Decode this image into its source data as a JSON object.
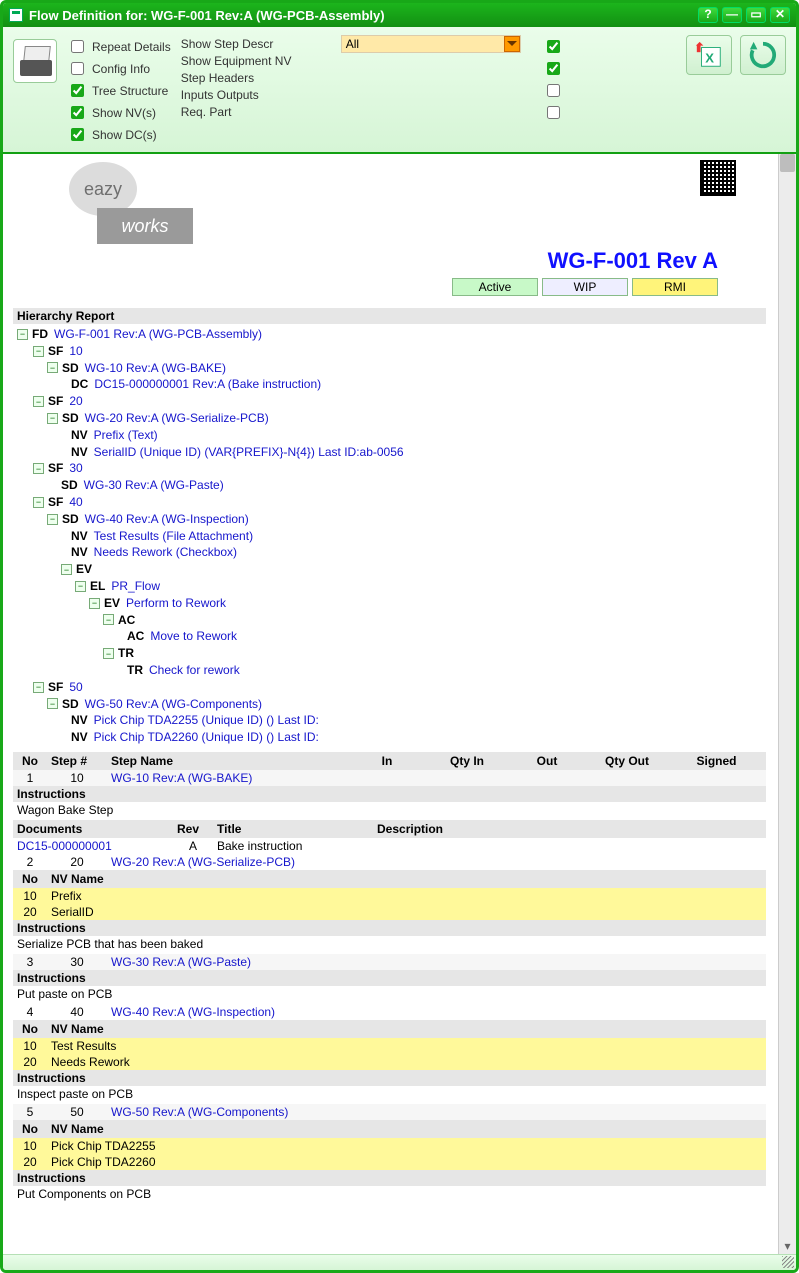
{
  "window": {
    "title": "Flow Definition for: WG-F-001 Rev:A (WG-PCB-Assembly)",
    "help": "?",
    "minimize": "—",
    "restore": "▭",
    "close": "✕"
  },
  "toolbar": {
    "options_left": {
      "repeat_details": "Repeat Details",
      "config_info": "Config Info",
      "tree_structure": "Tree Structure",
      "show_nvs": "Show NV(s)",
      "show_dcs": "Show DC(s)"
    },
    "labels": {
      "show_step_descr": "Show Step Descr",
      "show_equipment_nv": "Show Equipment NV",
      "step_headers": "Step Headers",
      "inputs_outputs": "Inputs Outputs",
      "req_part": "Req. Part"
    },
    "filter_value": "All"
  },
  "logo": {
    "bubble": "eazy",
    "box": "works"
  },
  "doc_title": "WG-F-001 Rev A",
  "status": {
    "active": "Active",
    "wip": "WIP",
    "rmi": "RMI"
  },
  "hierarchy_title": "Hierarchy Report",
  "tree": {
    "fd": "WG-F-001 Rev:A (WG-PCB-Assembly)",
    "sf10": "10",
    "sd10": "WG-10 Rev:A (WG-BAKE)",
    "dc": "DC15-000000001 Rev:A (Bake instruction)",
    "sf20": "20",
    "sd20": "WG-20 Rev:A (WG-Serialize-PCB)",
    "nv_prefix": "Prefix (Text)",
    "nv_serial": "SerialID (Unique ID) (VAR{PREFIX}-N{4}) Last ID:ab-0056",
    "sf30": "30",
    "sd30": "WG-30 Rev:A (WG-Paste)",
    "sf40": "40",
    "sd40": "WG-40 Rev:A (WG-Inspection)",
    "nv_test": "Test Results (File Attachment)",
    "nv_rework": "Needs Rework (Checkbox)",
    "ev": "",
    "el": "PR_Flow",
    "ev_perform": "Perform to Rework",
    "ac": "",
    "ac_move": "Move to Rework",
    "tr": "",
    "tr_check": "Check for rework",
    "sf50": "50",
    "sd50": "WG-50 Rev:A (WG-Components)",
    "nv_chip1": "Pick Chip TDA2255 (Unique ID) () Last ID:",
    "nv_chip2": "Pick Chip TDA2260 (Unique ID) () Last ID:"
  },
  "tags": {
    "fd": "FD",
    "sf": "SF",
    "sd": "SD",
    "dc": "DC",
    "nv": "NV",
    "ev": "EV",
    "el": "EL",
    "ac": "AC",
    "tr": "TR"
  },
  "table_head": {
    "no": "No",
    "step": "Step #",
    "name": "Step Name",
    "in": "In",
    "qtyin": "Qty In",
    "out": "Out",
    "qtyout": "Qty Out",
    "signed": "Signed"
  },
  "steps": [
    {
      "no": "1",
      "num": "10",
      "name": "WG-10 Rev:A (WG-BAKE)",
      "instr": "Wagon Bake Step",
      "docs": [
        {
          "id": "DC15-000000001",
          "rev": "A",
          "title": "Bake instruction"
        }
      ]
    },
    {
      "no": "2",
      "num": "20",
      "name": "WG-20 Rev:A (WG-Serialize-PCB)",
      "instr": "Serialize PCB that has been baked",
      "nv": [
        {
          "no": "10",
          "name": "Prefix"
        },
        {
          "no": "20",
          "name": "SerialID"
        }
      ]
    },
    {
      "no": "3",
      "num": "30",
      "name": "WG-30 Rev:A (WG-Paste)",
      "instr": "Put paste on PCB"
    },
    {
      "no": "4",
      "num": "40",
      "name": "WG-40 Rev:A (WG-Inspection)",
      "instr": "Inspect paste on PCB",
      "nv": [
        {
          "no": "10",
          "name": "Test Results"
        },
        {
          "no": "20",
          "name": "Needs Rework"
        }
      ]
    },
    {
      "no": "5",
      "num": "50",
      "name": "WG-50 Rev:A (WG-Components)",
      "instr": "Put Components on PCB",
      "nv": [
        {
          "no": "10",
          "name": "Pick Chip TDA2255"
        },
        {
          "no": "20",
          "name": "Pick Chip TDA2260"
        }
      ]
    }
  ],
  "labels": {
    "instructions": "Instructions",
    "documents": "Documents",
    "rev": "Rev",
    "title": "Title",
    "description": "Description",
    "nv_no": "No",
    "nv_name": "NV Name"
  }
}
